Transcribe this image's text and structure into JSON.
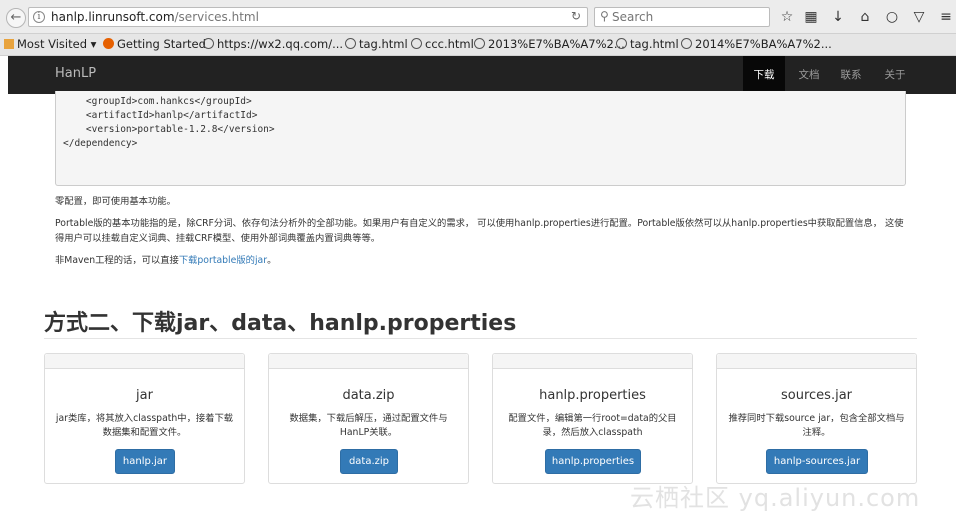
{
  "browser": {
    "url_domain": "hanlp.linrunsoft.com",
    "url_path": "/services.html",
    "search_placeholder": "Search"
  },
  "bookmarks": [
    "Most Visited ▾",
    "Getting Started",
    "https://wx2.qq.com/...",
    "tag.html",
    "ccc.html",
    "2013%E7%BA%A7%2...",
    "tag.html",
    "2014%E7%BA%A7%2..."
  ],
  "navbar": {
    "brand": "HanLP",
    "links": [
      "下载",
      "文档",
      "联系",
      "关于"
    ],
    "active_index": 0
  },
  "code_lines": [
    "    <groupId>com.hankcs</groupId>",
    "    <artifactId>hanlp</artifactId>",
    "    <version>portable-1.2.8</version>",
    "</dependency>"
  ],
  "paragraphs": {
    "p1": "零配置，即可使用基本功能。",
    "p2": "Portable版的基本功能指的是，除CRF分词、依存句法分析外的全部功能。如果用户有自定义的需求， 可以使用hanlp.properties进行配置。Portable版依然可以从hanlp.properties中获取配置信息， 这使得用户可以挂载自定义词典、挂载CRF模型、使用外部词典覆盖内置词典等等。",
    "p3_prefix": "非Maven工程的话，可以直接",
    "p3_link": "下载portable版的jar",
    "p3_suffix": "。"
  },
  "section_heading": "方式二、下载jar、data、hanlp.properties",
  "cards": [
    {
      "title": "jar",
      "desc": "jar类库，将其放入classpath中，接着下载数据集和配置文件。",
      "button": "hanlp.jar"
    },
    {
      "title": "data.zip",
      "desc": "数据集，下载后解压，通过配置文件与HanLP关联。",
      "button": "data.zip"
    },
    {
      "title": "hanlp.properties",
      "desc": "配置文件，编辑第一行root=data的父目录，然后放入classpath",
      "button": "hanlp.properties"
    },
    {
      "title": "sources.jar",
      "desc": "推荐同时下载source jar，包含全部文档与注释。",
      "button": "hanlp-sources.jar"
    }
  ],
  "watermark": "云栖社区 yq.aliyun.com",
  "colors": {
    "navbar_bg": "#222222",
    "link": "#337ab7",
    "button_bg": "#337ab7"
  }
}
